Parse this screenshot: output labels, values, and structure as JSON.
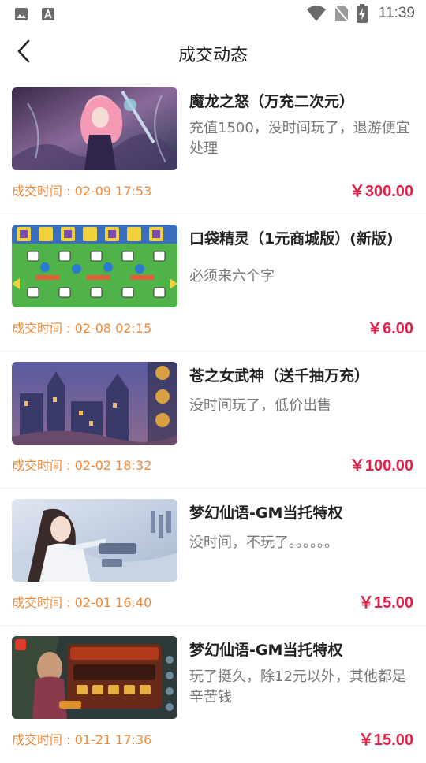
{
  "status_bar": {
    "time": "11:39",
    "icons": [
      "image-icon",
      "text-icon",
      "wifi-icon",
      "no-sim-icon",
      "battery-charging-icon"
    ]
  },
  "header": {
    "title": "成交动态",
    "back_icon": "back-arrow-icon"
  },
  "deals": [
    {
      "name": "魔龙之怒（万充二次元）",
      "desc": "充值1500，没时间玩了，退游便宜处理",
      "time": "成交时间 : 02-09 17:53",
      "price": "￥300.00",
      "thumb": "anime-girl-art"
    },
    {
      "name": "口袋精灵（1元商城版）(新版)",
      "desc": "必须来六个字",
      "time": "成交时间 : 02-08 02:15",
      "price": "￥6.00",
      "thumb": "pixel-monster-grid"
    },
    {
      "name": "苍之女武神（送千抽万充）",
      "desc": "没时间玩了，低价出售",
      "time": "成交时间 : 02-02 18:32",
      "price": "￥100.00",
      "thumb": "night-castle-town"
    },
    {
      "name": "梦幻仙语-GM当托特权",
      "desc": "没时间，不玩了。。。。。。",
      "time": "成交时间 : 02-01 16:40",
      "price": "￥15.00",
      "thumb": "fairy-lady-snow"
    },
    {
      "name": "梦幻仙语-GM当托特权",
      "desc": "玩了挺久，除12元以外，其他都是辛苦钱",
      "time": "成交时间 : 01-21 17:36",
      "price": "￥15.00",
      "thumb": "game-shop-dialog"
    }
  ],
  "colors": {
    "time_orange": "#f08a3c",
    "price_red": "#e0224a",
    "title_dark": "#222222",
    "desc_gray": "#777777"
  }
}
